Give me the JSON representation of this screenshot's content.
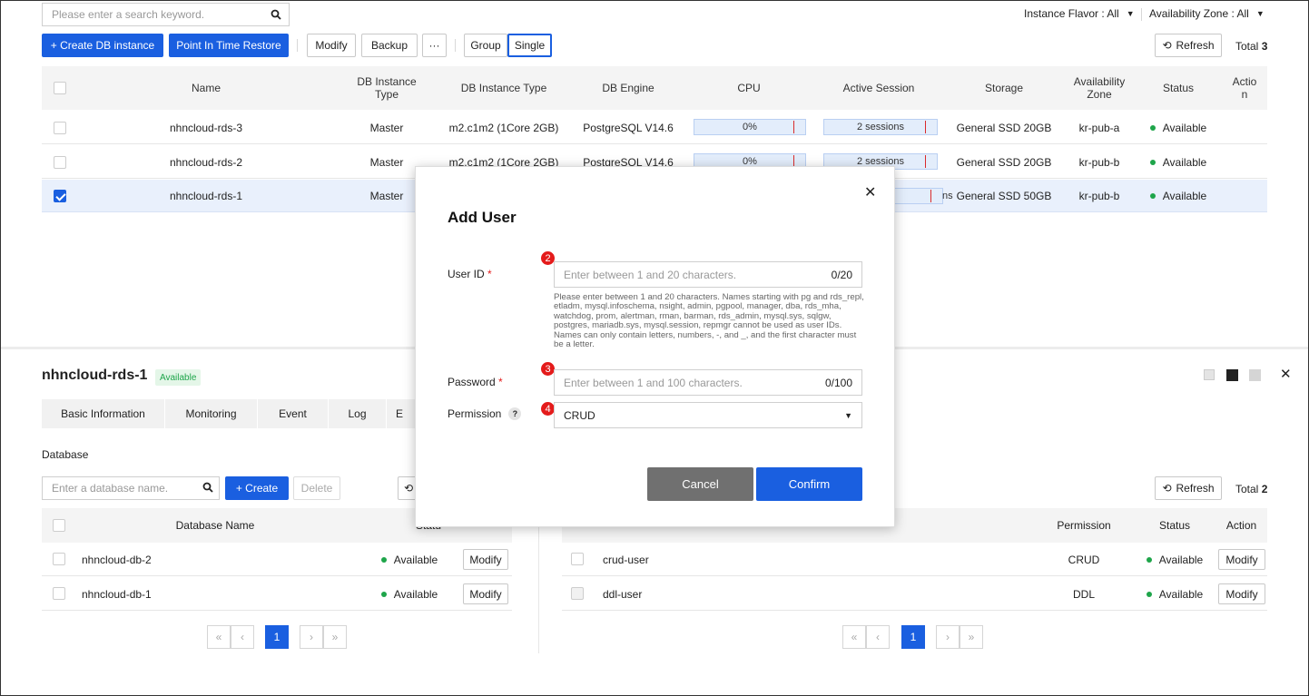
{
  "top": {
    "search_placeholder": "Please enter a search keyword.",
    "instance_flavor": "Instance Flavor : All",
    "availability_zone": "Availability Zone : All",
    "create_label": "+ Create DB instance",
    "pitr_label": "Point In Time Restore",
    "modify_label": "Modify",
    "backup_label": "Backup",
    "more_label": "···",
    "group_label": "Group",
    "single_label": "Single",
    "refresh_label": "Refresh",
    "total_label": "Total",
    "total_count": "3"
  },
  "instances": {
    "headers": [
      "Name",
      "DB Instance\nType",
      "DB Instance Type",
      "DB Engine",
      "CPU",
      "Active Session",
      "Storage",
      "Availability\nZone",
      "Status",
      "Actio\nn"
    ],
    "rows": [
      {
        "name": "nhncloud-rds-3",
        "type": "Master",
        "flavor": "m2.c1m2 (1Core 2GB)",
        "engine": "PostgreSQL V14.6",
        "cpu": "0%",
        "cpu_level": 0.82,
        "session": "2 sessions",
        "session_level": 0.82,
        "storage": "General SSD 20GB",
        "zone": "kr-pub-a",
        "status": "Available",
        "checked": false
      },
      {
        "name": "nhncloud-rds-2",
        "type": "Master",
        "flavor": "m2.c1m2 (1Core 2GB)",
        "engine": "PostgreSQL V14.6",
        "cpu": "0%",
        "cpu_level": 0.82,
        "session": "2 sessions",
        "session_level": 0.82,
        "storage": "General SSD 20GB",
        "zone": "kr-pub-b",
        "status": "Available",
        "checked": false
      },
      {
        "name": "nhncloud-rds-1",
        "type": "Master",
        "flavor": "",
        "engine": "",
        "cpu": "",
        "session": "ns",
        "session_level": 0.82,
        "storage": "General SSD 50GB",
        "zone": "kr-pub-b",
        "status": "Available",
        "checked": true
      }
    ]
  },
  "detail": {
    "title": "nhncloud-rds-1",
    "badge": "Available",
    "tabs": [
      "Basic Information",
      "Monitoring",
      "Event",
      "Log",
      "E"
    ],
    "section_title": "Database",
    "db_search_placeholder": "Enter a database name.",
    "create_label": "+ Create",
    "delete_label": "Delete",
    "db_header_name": "Database Name",
    "db_header_status": "Statu",
    "databases": [
      {
        "name": "nhncloud-db-2",
        "status": "Available",
        "action": "Modify"
      },
      {
        "name": "nhncloud-db-1",
        "status": "Available",
        "action": "Modify"
      }
    ],
    "user_refresh_label": "Refresh",
    "user_total_label": "Total",
    "user_total_count": "2",
    "user_headers": {
      "permission": "Permission",
      "status": "Status",
      "action": "Action"
    },
    "users": [
      {
        "name": "crud-user",
        "permission": "CRUD",
        "status": "Available",
        "action": "Modify"
      },
      {
        "name": "ddl-user",
        "permission": "DDL",
        "status": "Available",
        "action": "Modify"
      }
    ],
    "pagination": {
      "first": "«",
      "prev": "‹",
      "page": "1",
      "next": "›",
      "last": "»"
    }
  },
  "modal": {
    "title": "Add User",
    "close": "✕",
    "userid_label": "User ID",
    "userid_placeholder": "Enter between 1 and 20 characters.",
    "userid_counter": "0/20",
    "userid_help": "Please enter between 1 and 20 characters. Names starting with pg and rds_repl, etladm, mysql.infoschema, nsight, admin, pgpool, manager, dba, rds_mha, watchdog, prom, alertman, rman, barman, rds_admin, mysql.sys, sqlgw, postgres, mariadb.sys, mysql.session, repmgr cannot be used as user IDs. Names can only contain letters, numbers, -, and _, and the first character must be a letter.",
    "password_label": "Password",
    "password_placeholder": "Enter between 1 and 100 characters.",
    "password_counter": "0/100",
    "permission_label": "Permission",
    "permission_help": "?",
    "permission_value": "CRUD",
    "required_mark": "*",
    "cancel_label": "Cancel",
    "confirm_label": "Confirm",
    "steps": [
      "2",
      "3",
      "4"
    ]
  },
  "colors": {
    "accent": "#1a5fe0",
    "status_green": "#1ea54a",
    "step_red": "#e41b1b"
  }
}
